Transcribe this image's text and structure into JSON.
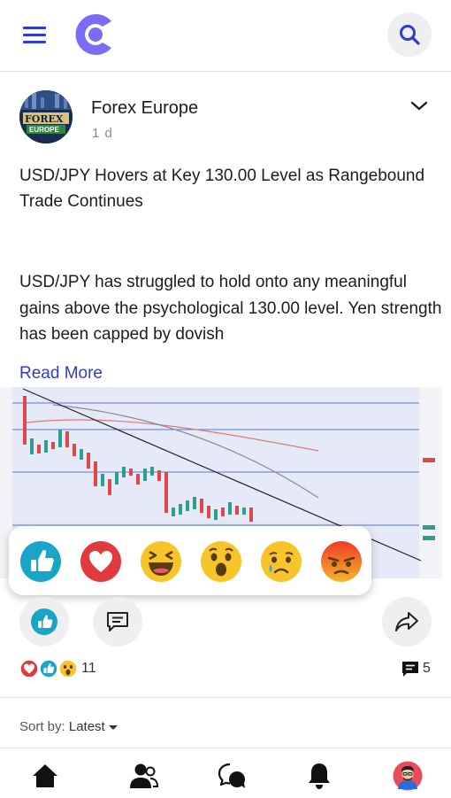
{
  "post": {
    "author": "Forex Europe",
    "time": "1 d",
    "avatar_text_top": "FOREX",
    "avatar_text_bottom": "EUROPE",
    "title": "USD/JPY Hovers at Key 130.00 Level as Rangebound Trade Continues",
    "body": "USD/JPY has struggled to hold onto any meaningful gains above the psychological 130.00 level. Yen strength has been capped by dovish",
    "read_more": "Read More"
  },
  "reactions": {
    "options": [
      "like-icon",
      "love-icon",
      "haha-icon",
      "wow-icon",
      "sad-icon",
      "angry-icon"
    ],
    "count": "11",
    "comment_count": "5"
  },
  "sort": {
    "label": "Sort by:",
    "value": "Latest"
  },
  "colors": {
    "accent": "#2f3bd1",
    "logo": "#7b6cf6",
    "like": "#1aa5c8",
    "love": "#e0393e",
    "emoji_yellow": "#f7c52a",
    "angry": "#ee5a24"
  },
  "nav": [
    "home-icon",
    "users-icon",
    "chat-icon",
    "bell-icon",
    "profile-avatar"
  ]
}
